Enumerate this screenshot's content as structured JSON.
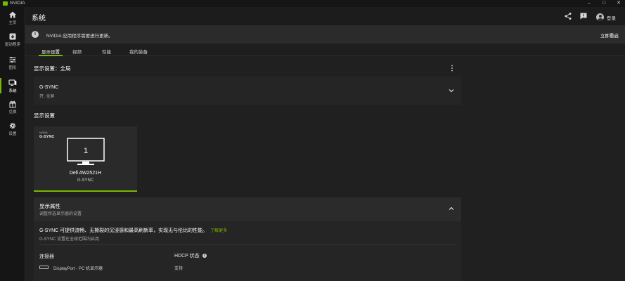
{
  "window": {
    "app_name": "NVIDIA",
    "controls": {
      "minimize": "–",
      "maximize": "□",
      "close": "✕"
    }
  },
  "sidebar": {
    "items": [
      {
        "label": "主页",
        "icon": "home-icon"
      },
      {
        "label": "驱动程序",
        "icon": "driver-download-icon"
      },
      {
        "label": "图形",
        "icon": "sliders-icon"
      },
      {
        "label": "系统",
        "icon": "system-monitor-icon",
        "active": true
      },
      {
        "label": "兑换",
        "icon": "gift-icon"
      },
      {
        "label": "设置",
        "icon": "gear-icon"
      }
    ]
  },
  "header": {
    "title": "系统",
    "login_label": "登录"
  },
  "notice": {
    "message": "NVIDIA 应用程序需要进行更新。",
    "action": "立即重启"
  },
  "tabs": [
    {
      "label": "显示设置",
      "active": true
    },
    {
      "label": "视频"
    },
    {
      "label": "性能"
    },
    {
      "label": "我的装备"
    }
  ],
  "display_settings": {
    "scope_title": "显示设置：全局",
    "gsync": {
      "title": "G-SYNC",
      "status": "开, 全屏"
    },
    "section_title": "显示设置",
    "display_card": {
      "logo_brand": "NVIDIA",
      "logo_text": "G-SYNC",
      "monitor_number": "1",
      "name": "Dell AW2521H",
      "sub": "G-SYNC"
    },
    "properties": {
      "title": "显示属性",
      "subtitle": "调整所选显示器的设置",
      "gsync_description": "G-SYNC 可提供流畅、无撕裂的沉浸感和最高刷新率，实现无与伦比的性能。",
      "learn_more": "了解更多",
      "gsync_note": "G-SYNC 设置在全球范围内启用",
      "connector_label": "连接器",
      "connector_value": "DisplayPort - PC 机显示器",
      "hdcp_label": "HDCP 状态",
      "hdcp_value": "支持"
    }
  },
  "colors": {
    "accent": "#76b900",
    "background": "#202020",
    "panel": "#252525"
  }
}
